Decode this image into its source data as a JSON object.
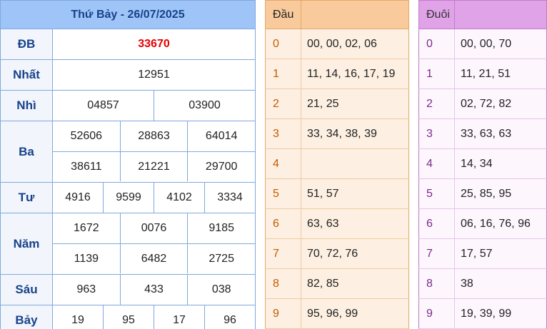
{
  "results": {
    "title": "Thứ Bảy - 26/07/2025",
    "prizes": [
      {
        "label": "ĐB",
        "lines": [
          [
            "33670"
          ]
        ],
        "special": true
      },
      {
        "label": "Nhất",
        "lines": [
          [
            "12951"
          ]
        ]
      },
      {
        "label": "Nhì",
        "lines": [
          [
            "04857",
            "03900"
          ]
        ]
      },
      {
        "label": "Ba",
        "lines": [
          [
            "52606",
            "28863",
            "64014"
          ],
          [
            "38611",
            "21221",
            "29700"
          ]
        ]
      },
      {
        "label": "Tư",
        "lines": [
          [
            "4916",
            "9599",
            "4102",
            "3334"
          ]
        ]
      },
      {
        "label": "Năm",
        "lines": [
          [
            "1672",
            "0076",
            "9185"
          ],
          [
            "1139",
            "6482",
            "2725"
          ]
        ]
      },
      {
        "label": "Sáu",
        "lines": [
          [
            "963",
            "433",
            "038"
          ]
        ]
      },
      {
        "label": "Bảy",
        "lines": [
          [
            "19",
            "95",
            "17",
            "96"
          ]
        ]
      }
    ]
  },
  "dau": {
    "title": "Đầu",
    "rows": [
      {
        "key": "0",
        "value": "00, 00, 02, 06"
      },
      {
        "key": "1",
        "value": "11, 14, 16, 17, 19"
      },
      {
        "key": "2",
        "value": "21, 25"
      },
      {
        "key": "3",
        "value": "33, 34, 38, 39"
      },
      {
        "key": "4",
        "value": ""
      },
      {
        "key": "5",
        "value": "51, 57"
      },
      {
        "key": "6",
        "value": "63, 63"
      },
      {
        "key": "7",
        "value": "70, 72, 76"
      },
      {
        "key": "8",
        "value": "82, 85"
      },
      {
        "key": "9",
        "value": "95, 96, 99"
      }
    ]
  },
  "duoi": {
    "title": "Đuôi",
    "rows": [
      {
        "key": "0",
        "value": "00, 00, 70"
      },
      {
        "key": "1",
        "value": "11, 21, 51"
      },
      {
        "key": "2",
        "value": "02, 72, 82"
      },
      {
        "key": "3",
        "value": "33, 63, 63"
      },
      {
        "key": "4",
        "value": "14, 34"
      },
      {
        "key": "5",
        "value": "25, 85, 95"
      },
      {
        "key": "6",
        "value": "06, 16, 76, 96"
      },
      {
        "key": "7",
        "value": "17, 57"
      },
      {
        "key": "8",
        "value": "38"
      },
      {
        "key": "9",
        "value": "19, 39, 99"
      }
    ]
  },
  "colors": {
    "header_blue": "#9fc5f8",
    "special_red": "#e60000",
    "dau_header": "#f9cb9c",
    "duoi_header": "#e0a3e8"
  }
}
